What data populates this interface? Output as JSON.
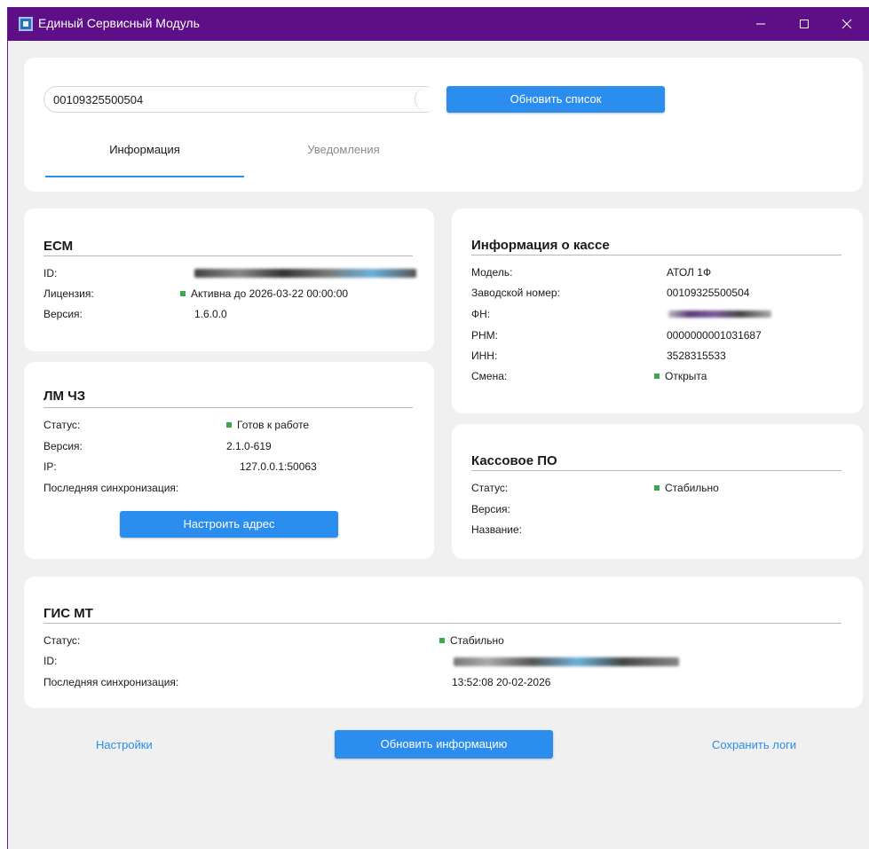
{
  "window": {
    "title": "Единый Сервисный Модуль",
    "titlebar_color": "#5e0f87"
  },
  "top": {
    "search_value": "00109325500504",
    "refresh_list_label": "Обновить список",
    "tabs": [
      {
        "label": "Информация",
        "active": true
      },
      {
        "label": "Уведомления",
        "active": false
      }
    ]
  },
  "ecm": {
    "title": "ЕСМ",
    "id_label": "ID:",
    "license_label": "Лицензия:",
    "license_value": "Активна до 2026-03-22 00:00:00",
    "version_label": "Версия:",
    "version_value": "1.6.0.0"
  },
  "lm": {
    "title": "ЛМ ЧЗ",
    "status_label": "Статус:",
    "status_value": "Готов к работе",
    "version_label": "Версия:",
    "version_value": "2.1.0-619",
    "ip_label": "IP:",
    "ip_value": "127.0.0.1:50063",
    "sync_label": "Последняя синхронизация:",
    "configure_label": "Настроить адрес"
  },
  "kassa": {
    "title": "Информация о кассе",
    "model_label": "Модель:",
    "model_value": "АТОЛ 1Ф",
    "serial_label": "Заводской номер:",
    "serial_value": "00109325500504",
    "fn_label": "ФН:",
    "rnm_label": "РНМ:",
    "rnm_value": "0000000001031687",
    "inn_label": "ИНН:",
    "inn_value": "3528315533",
    "shift_label": "Смена:",
    "shift_value": "Открыта"
  },
  "po": {
    "title": "Кассовое ПО",
    "status_label": "Статус:",
    "status_value": "Стабильно",
    "version_label": "Версия:",
    "name_label": "Название:"
  },
  "gis": {
    "title": "ГИС МТ",
    "status_label": "Статус:",
    "status_value": "Стабильно",
    "id_label": "ID:",
    "sync_label": "Последняя синхронизация:",
    "sync_value": "13:52:08 20-02-2026"
  },
  "footer": {
    "settings_label": "Настройки",
    "update_info_label": "Обновить информацию",
    "save_logs_label": "Сохранить логи"
  },
  "colors": {
    "accent": "#2b8ded",
    "status_ok": "#3aa84d"
  }
}
